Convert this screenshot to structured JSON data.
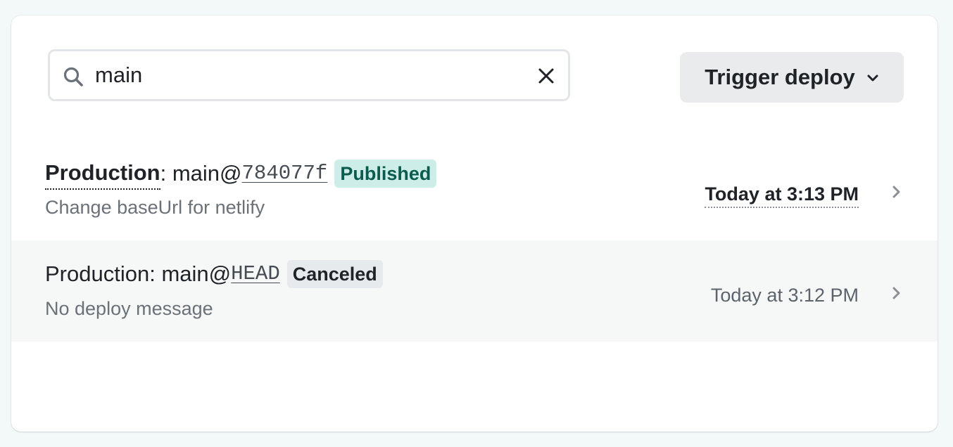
{
  "search": {
    "value": "main",
    "icon": "search-icon",
    "clear_icon": "close-icon"
  },
  "trigger_button": {
    "label": "Trigger deploy",
    "icon": "chevron-down-icon"
  },
  "deploys": [
    {
      "context": "Production",
      "separator": ": ",
      "branch": "main@",
      "ref": "784077f",
      "status": "Published",
      "message": "Change baseUrl for netlify",
      "time": "Today at 3:13 PM",
      "status_color": "#cdeee8"
    },
    {
      "context": "Production",
      "separator": ": ",
      "branch": "main@",
      "ref": "HEAD",
      "status": "Canceled",
      "message": "No deploy message",
      "time": "Today at 3:12 PM",
      "status_color": "#e7eaec"
    }
  ]
}
